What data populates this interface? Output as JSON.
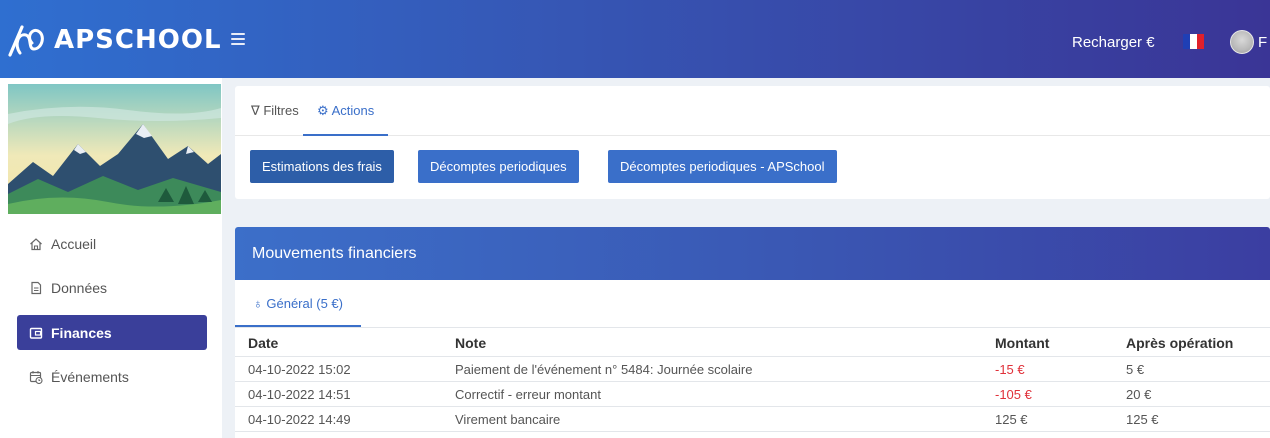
{
  "header": {
    "brand": "APSCHOOL",
    "recharge_label": "Recharger €",
    "flag_colors": [
      "#1f3fb5",
      "#ffffff",
      "#e0202a"
    ],
    "user_initial": "F"
  },
  "sidebar": {
    "items": [
      {
        "label": "Accueil",
        "icon": "home-icon"
      },
      {
        "label": "Données",
        "icon": "document-icon"
      },
      {
        "label": "Finances",
        "icon": "wallet-icon"
      },
      {
        "label": "Événements",
        "icon": "calendar-clock-icon"
      }
    ],
    "active_index": 2
  },
  "toolbar": {
    "tabs": [
      {
        "label": "Filtres",
        "icon": "filter-icon"
      },
      {
        "label": "Actions",
        "icon": "gear-icon"
      }
    ],
    "active_tab": "Actions",
    "buttons": [
      "Estimations des frais",
      "Décomptes periodiques",
      "Décomptes periodiques - APSchool"
    ]
  },
  "movements": {
    "title": "Mouvements financiers",
    "tab_label": "Général (5 €)",
    "tab_icon": "piggy-bank-icon",
    "columns": [
      "Date",
      "Note",
      "Montant",
      "Après opération"
    ],
    "rows": [
      {
        "date": "04-10-2022 15:02",
        "note": "Paiement de l'événement n° 5484: Journée scolaire",
        "montant": "-15 €",
        "apres": "5 €",
        "negative": true
      },
      {
        "date": "04-10-2022 14:51",
        "note": "Correctif - erreur montant",
        "montant": "-105 €",
        "apres": "20 €",
        "negative": true
      },
      {
        "date": "04-10-2022 14:49",
        "note": "Virement bancaire",
        "montant": "125 €",
        "apres": "125 €",
        "negative": false
      }
    ]
  },
  "colors": {
    "accent": "#3a6fc9",
    "active_nav": "#3a3f9a",
    "negative": "#e0313a"
  }
}
